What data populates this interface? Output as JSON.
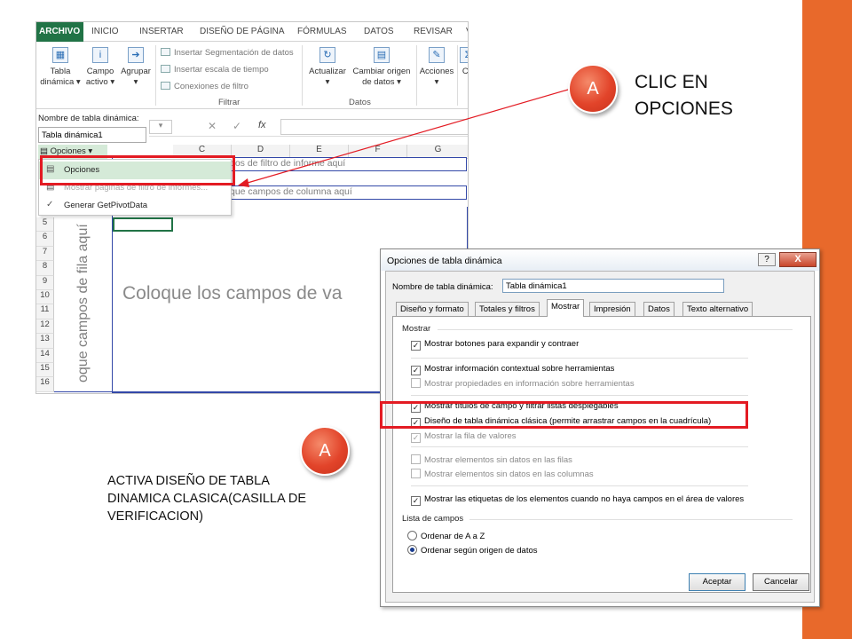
{
  "slide": {
    "accent_color": "#e8692b",
    "callout_text": "CLIC EN OPCIONES",
    "note_text": "ACTIVA DISEÑO DE TABLA DINAMICA CLASICA(CASILLA DE VERIFICACION)",
    "badge1": "A",
    "badge2": "A"
  },
  "excel": {
    "tabs": [
      "ARCHIVO",
      "INICIO",
      "INSERTAR",
      "DISEÑO DE PÁGINA",
      "FÓRMULAS",
      "DATOS",
      "REVISAR",
      "V"
    ],
    "ribbon": {
      "tabla_dinamica": "Tabla dinámica",
      "campo_activo": "Campo activo",
      "agrupar": "Agrupar",
      "seg_datos": "Insertar Segmentación de datos",
      "escala_tiempo": "Insertar escala de tiempo",
      "conexiones": "Conexiones de filtro",
      "filtrar": "Filtrar",
      "actualizar": "Actualizar",
      "cambiar_origen": "Cambiar origen de datos",
      "datos": "Datos",
      "acciones": "Acciones",
      "ca": "Ca"
    },
    "namebox_label": "Nombre de tabla dinámica:",
    "namebox_value": "Tabla dinámica1",
    "opciones_button": "Opciones",
    "fx": "fx",
    "columns": [
      "C",
      "D",
      "E",
      "F",
      "G"
    ],
    "rows": [
      "5",
      "6",
      "7",
      "8",
      "9",
      "10",
      "11",
      "12",
      "13",
      "14",
      "15",
      "16"
    ],
    "pivot_filter_text": "pos de filtro de informe aquí",
    "pivot_column_text": "que campos de columna aquí",
    "pivot_row_text": "oque campos de fila aquí",
    "pivot_values_text": "Coloque los campos de va",
    "menu": {
      "opciones": "Opciones",
      "mostrar_paginas": "Mostrar páginas de filtro de informes...",
      "generar": "Generar GetPivotData"
    }
  },
  "dialog": {
    "title": "Opciones de tabla dinámica",
    "help": "?",
    "close": "X",
    "name_label": "Nombre de tabla dinámica:",
    "name_value": "Tabla dinámica1",
    "tabs": [
      "Diseño y formato",
      "Totales y filtros",
      "Mostrar",
      "Impresión",
      "Datos",
      "Texto alternativo"
    ],
    "active_tab": "Mostrar",
    "section_mostrar": "Mostrar",
    "options": [
      {
        "label": "Mostrar botones para expandir y contraer",
        "checked": true,
        "disabled": false
      },
      {
        "label": "Mostrar información contextual sobre herramientas",
        "checked": true,
        "disabled": false
      },
      {
        "label": "Mostrar propiedades en información sobre herramientas",
        "checked": false,
        "disabled": true
      },
      {
        "label": "Mostrar títulos de campo y filtrar listas desplegables",
        "checked": true,
        "disabled": false
      },
      {
        "label": "Diseño de tabla dinámica clásica (permite arrastrar campos en la cuadrícula)",
        "checked": true,
        "disabled": false
      },
      {
        "label": "Mostrar la fila de valores",
        "checked": true,
        "disabled": true
      },
      {
        "label": "Mostrar elementos sin datos en las filas",
        "checked": false,
        "disabled": true
      },
      {
        "label": "Mostrar elementos sin datos en las columnas",
        "checked": false,
        "disabled": true
      },
      {
        "label": "Mostrar las etiquetas de los elementos cuando no haya campos en el área de valores",
        "checked": true,
        "disabled": false
      }
    ],
    "section_lista": "Lista de campos",
    "radio_az": "Ordenar de A a Z",
    "radio_origen": "Ordenar según origen de datos",
    "accept": "Aceptar",
    "cancel": "Cancelar"
  }
}
